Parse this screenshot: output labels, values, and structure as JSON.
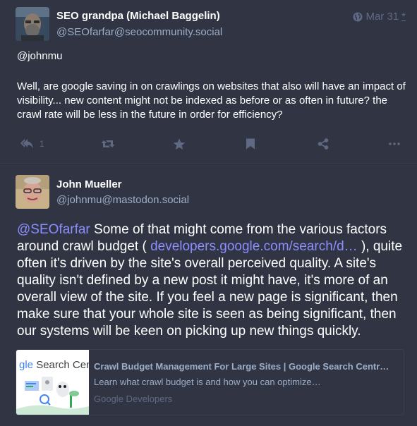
{
  "post1": {
    "display_name": "SEO grandpa (Michael Baggelin)",
    "acct": "@SEOfarfar@seocommunity.social",
    "visibility_icon": "globe-icon",
    "date": "Mar 31",
    "edited_marker": "*",
    "mention": "@johnmu",
    "body": "Well, are google saving in on crawlings on websites that also will have an impact of visibility... new content might not be indexed as before or as often in future? the crawl rate will be less in the future in order for efficiency?",
    "actions": {
      "reply_icon": "reply-all-icon",
      "reply_count": "1",
      "boost_icon": "retweet-icon",
      "favourite_icon": "star-icon",
      "bookmark_icon": "bookmark-icon",
      "share_icon": "share-icon",
      "more_icon": "ellipsis-icon"
    }
  },
  "post2": {
    "display_name": "John Mueller",
    "acct": "@johnmu@mastodon.social",
    "mention": "@SEOfarfar",
    "text_before_link": " Some of that might come from the various factors around crawl budget ( ",
    "link_text": "developers.google.com/search/d…",
    "text_after_link": " ), quite often it's driven by the site's overall perceived quality. A site's quality isn't defined by a new post it might have, it's more of an overall view of the site. If you feel a new page is significant, then make sure that your whole site is seen as being significant, then our systems will be keen on picking up new things quickly.",
    "card": {
      "thumb_text_g": "gle",
      "thumb_text_rest": " Search Cen",
      "title": "Crawl Budget Management For Large Sites | Google Search Centr…",
      "description": "Learn what crawl budget is and how you can optimize…",
      "provider": "Google Developers"
    }
  },
  "colors": {
    "background": "#282c37",
    "status_background": "#313543",
    "text": "#ffffff",
    "secondary_text": "#9baec8",
    "muted": "#606984",
    "link": "#8c8dff"
  }
}
